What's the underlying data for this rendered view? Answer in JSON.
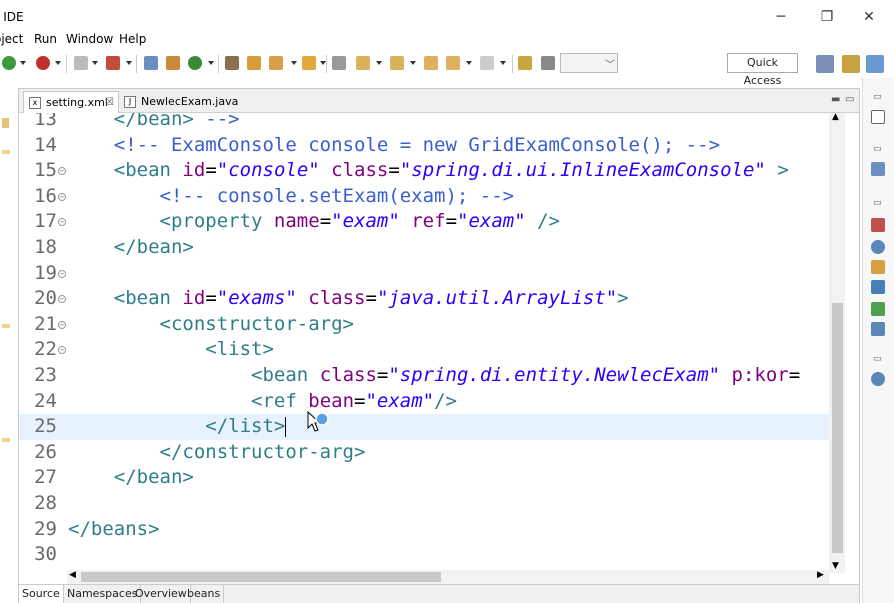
{
  "window": {
    "title": "e IDE",
    "minimize": "─",
    "maximize": "❐",
    "close": "✕"
  },
  "menu": [
    "oject",
    "Run",
    "Window",
    "Help"
  ],
  "toolbar": {
    "quick_access": "Quick Access"
  },
  "tabs": [
    {
      "label": "setting.xml",
      "close": "☒",
      "active": true,
      "icon": "xml-file-icon"
    },
    {
      "label": "NewlecExam.java",
      "active": false,
      "icon": "java-file-icon"
    }
  ],
  "code_lines": [
    {
      "num": "13",
      "fold": "",
      "html": "    <span class='tag'>&lt;/bean&gt;</span> <span class='cmt'>--&gt;</span>"
    },
    {
      "num": "14",
      "fold": "",
      "html": "    <span class='cmt'>&lt;!-- ExamConsole console = new GridExamConsole(); --&gt;</span>"
    },
    {
      "num": "15",
      "fold": "⊖",
      "html": "    <span class='tag'>&lt;bean</span> <span class='attr'>id</span>=<span class='val'>\"console\"</span> <span class='attr'>class</span>=<span class='val'>\"spring.di.ui.InlineExamConsole\"</span> <span class='tag'>&gt;</span>"
    },
    {
      "num": "16",
      "fold": "⊖",
      "html": "        <span class='cmt'>&lt;!-- console.setExam(exam); --&gt;</span>"
    },
    {
      "num": "17",
      "fold": "⊖",
      "html": "        <span class='tag'>&lt;property</span> <span class='attr'>name</span>=<span class='val'>\"exam\"</span> <span class='attr'>ref</span>=<span class='val'>\"exam\"</span> <span class='tag'>/&gt;</span>"
    },
    {
      "num": "18",
      "fold": "",
      "html": "    <span class='tag'>&lt;/bean&gt;</span>"
    },
    {
      "num": "19",
      "fold": "⊖",
      "html": ""
    },
    {
      "num": "20",
      "fold": "⊖",
      "html": "    <span class='tag'>&lt;bean</span> <span class='attr'>id</span>=<span class='val'>\"exams\"</span> <span class='attr'>class</span>=<span class='val'>\"java.util.ArrayList\"</span><span class='tag'>&gt;</span>"
    },
    {
      "num": "21",
      "fold": "⊖",
      "html": "        <span class='tag'>&lt;constructor-arg&gt;</span>"
    },
    {
      "num": "22",
      "fold": "⊖",
      "html": "            <span class='tag'>&lt;list&gt;</span>"
    },
    {
      "num": "23",
      "fold": "",
      "html": "                <span class='tag'>&lt;bean</span> <span class='attr'>class</span>=<span class='val'>\"spring.di.entity.NewlecExam\"</span> <span class='attr'>p:kor</span>="
    },
    {
      "num": "24",
      "fold": "",
      "html": "                <span class='tag'>&lt;ref</span> <span class='attr'>bean</span>=<span class='val'>\"exam\"</span><span class='tag'>/&gt;</span>"
    },
    {
      "num": "25",
      "fold": "",
      "html": "            <span class='tag'>&lt;/list&gt;</span><span class='caret'></span>",
      "current": true
    },
    {
      "num": "26",
      "fold": "",
      "html": "        <span class='tag'>&lt;/constructor-arg&gt;</span>"
    },
    {
      "num": "27",
      "fold": "",
      "html": "    <span class='tag'>&lt;/bean&gt;</span>"
    },
    {
      "num": "28",
      "fold": "",
      "html": ""
    },
    {
      "num": "29",
      "fold": "",
      "html": "<span class='tag'>&lt;/beans&gt;</span>"
    },
    {
      "num": "30",
      "fold": "",
      "html": ""
    }
  ],
  "bottom_tabs": [
    "Source",
    "Namespaces",
    "Overview",
    "beans"
  ],
  "colors": {
    "tag": "#2f7d8c",
    "comment": "#3a5fcd",
    "attribute": "#7f007f",
    "value": "#2a00ff",
    "current_line": "#e8f2fe"
  }
}
